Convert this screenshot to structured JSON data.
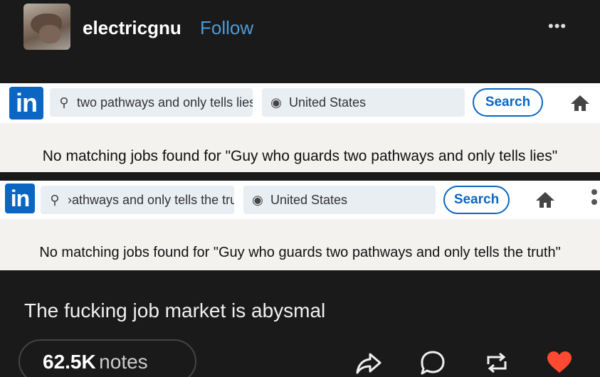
{
  "post": {
    "username": "electricgnu",
    "follow_label": "Follow",
    "more_label": "•••"
  },
  "panel1": {
    "logo": "in",
    "search_query": "two pathways and only tells lies",
    "location": "United States",
    "search_label": "Search",
    "message": "No matching jobs found for \"Guy who guards two pathways and only tells lies\""
  },
  "panel2": {
    "logo": "in",
    "search_query": "›athways and only tells the truth",
    "location": "United States",
    "search_label": "Search",
    "message": "No matching jobs found for \"Guy who guards two pathways and only tells the truth\""
  },
  "caption": "The fucking job market is abysmal",
  "footer": {
    "notes_count": "62.5K",
    "notes_label": "notes",
    "icons": [
      "share-icon",
      "comment-icon",
      "reblog-icon",
      "like-icon"
    ]
  },
  "colors": {
    "background": "#1a1a1a",
    "follow": "#4e9bd6",
    "linkedin_blue": "#0a66c2",
    "like": "#ff4930"
  }
}
